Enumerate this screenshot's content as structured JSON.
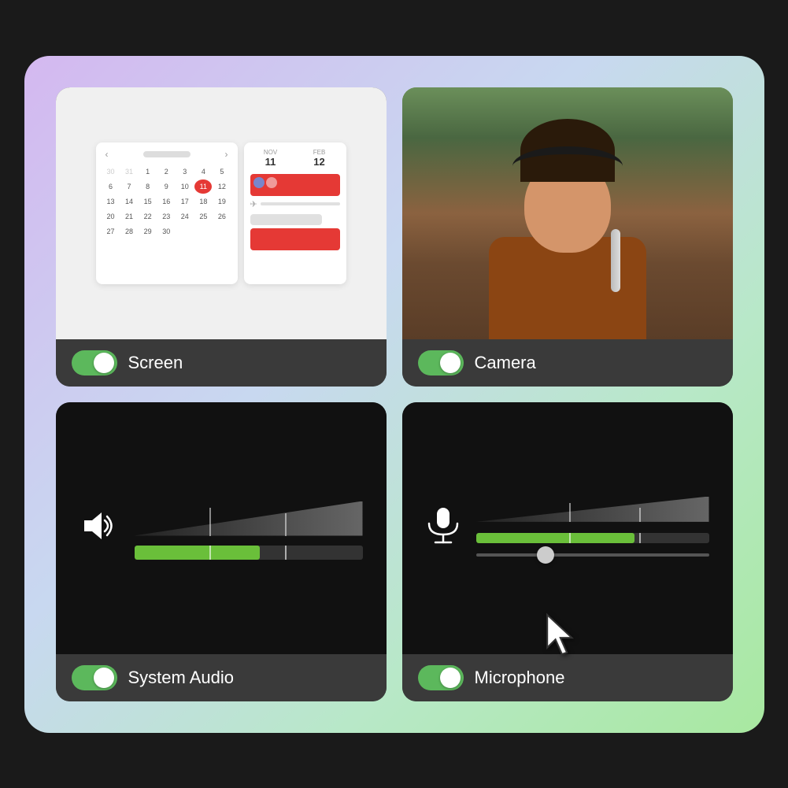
{
  "background": "#1a1a1a",
  "cards": {
    "screen": {
      "label": "Screen",
      "toggle_on": true
    },
    "camera": {
      "label": "Camera",
      "toggle_on": true
    },
    "system_audio": {
      "label": "System Audio",
      "toggle_on": true,
      "level_percent": 55
    },
    "microphone": {
      "label": "Microphone",
      "toggle_on": true,
      "level_percent": 68,
      "slider_percent": 32
    }
  },
  "calendar": {
    "days": [
      "30",
      "31",
      "1",
      "2",
      "3",
      "4",
      "5",
      "6",
      "7",
      "8",
      "9",
      "10",
      "11",
      "12",
      "13",
      "14",
      "15",
      "16",
      "17",
      "18",
      "19",
      "20",
      "21",
      "22",
      "23",
      "24",
      "25",
      "26",
      "27",
      "28",
      "29",
      "30"
    ],
    "today": "11"
  },
  "schedule": {
    "col1_label": "NOV",
    "col1_day": "11",
    "col2_label": "FEB",
    "col2_day": "12"
  },
  "colors": {
    "toggle_on": "#5cb85c",
    "card_bg": "#3a3a3a",
    "dark_card_bg": "#111111",
    "bar_fill": "#6abf3a",
    "gradient_start": "#d4b8f0",
    "gradient_end": "#a8e8a0"
  }
}
